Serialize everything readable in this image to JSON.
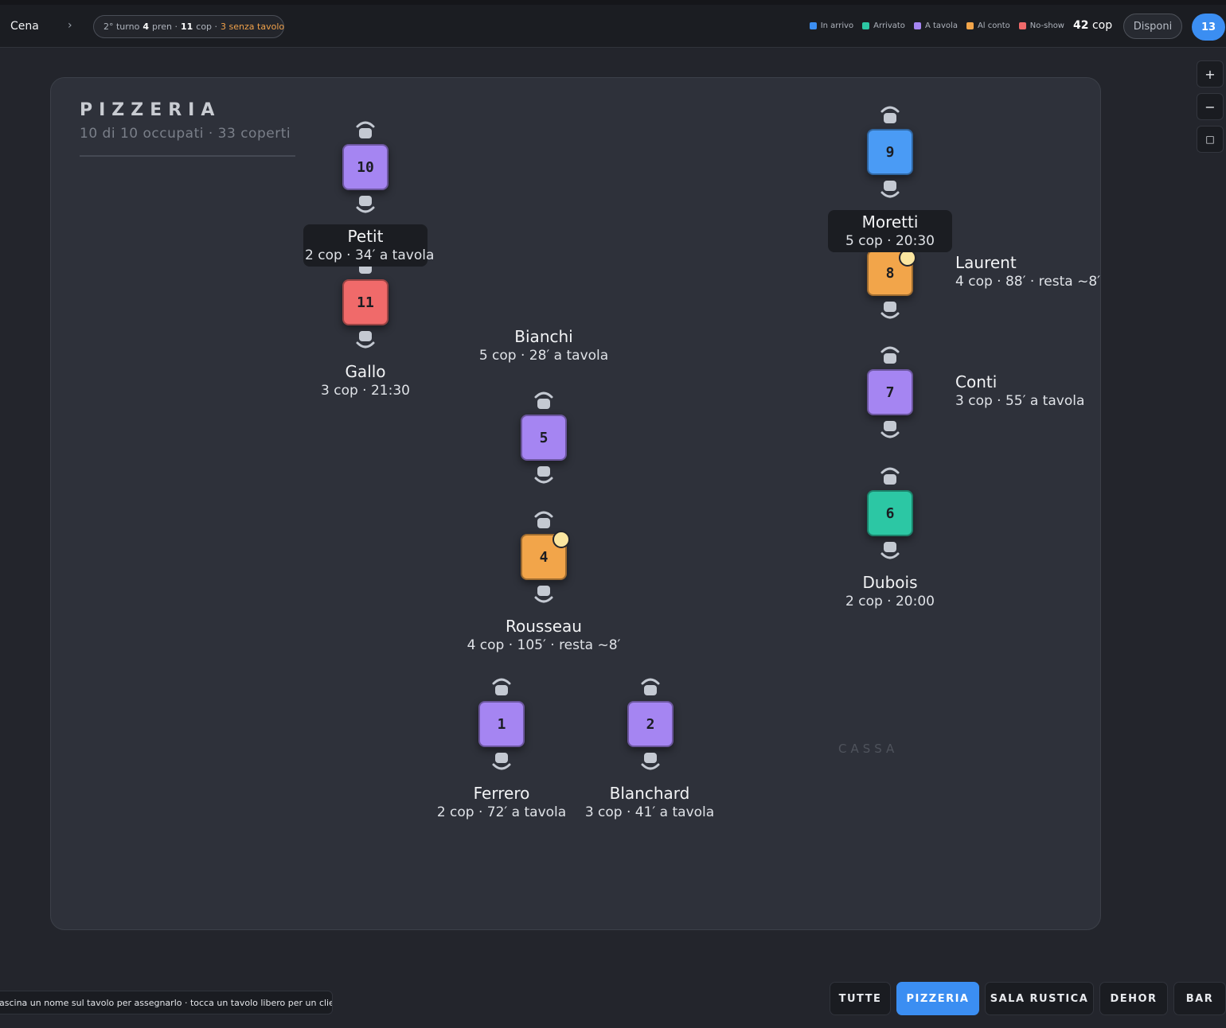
{
  "header": {
    "service": "Cena",
    "chevron": "›",
    "shift": {
      "turn": "2° turno",
      "reservations_num": "4",
      "reservations_label": "pren ·",
      "covers_num": "11",
      "covers_label": "cop ·",
      "unseated": "3 senza tavolo"
    },
    "legend": [
      {
        "label": "In arrivo",
        "color": "#3b8ef2"
      },
      {
        "label": "Arrivato",
        "color": "#2cc7a4"
      },
      {
        "label": "A tavola",
        "color": "#a585f2"
      },
      {
        "label": "Al conto",
        "color": "#f2a54a"
      },
      {
        "label": "No-show",
        "color": "#f06a6a"
      }
    ],
    "total_covers_num": "42",
    "total_covers_label": "cop",
    "disponi_label": "Disponi",
    "badge_count": "13"
  },
  "zoom": {
    "in": "+",
    "out": "−",
    "fit": "□"
  },
  "room": {
    "title": "PIZZERIA",
    "subtitle": "10 di 10 occupati · 33 coperti",
    "cassa_label": "CASSA"
  },
  "tables": [
    {
      "number": "10",
      "status": "A tavola",
      "color": "#a585f2"
    },
    {
      "number": "11",
      "status": "No-show",
      "color": "#f06a6a"
    },
    {
      "number": "9",
      "status": "In arrivo",
      "color": "#4a9bf5"
    },
    {
      "number": "8",
      "status": "Al conto",
      "color": "#f2a54a"
    },
    {
      "number": "7",
      "status": "A tavola",
      "color": "#a585f2"
    },
    {
      "number": "6",
      "status": "Arrivato",
      "color": "#2cc7a4"
    },
    {
      "number": "5",
      "status": "A tavola",
      "color": "#a585f2"
    },
    {
      "number": "4",
      "status": "Al conto",
      "color": "#f2a54a"
    },
    {
      "number": "1",
      "status": "A tavola",
      "color": "#a585f2"
    },
    {
      "number": "2",
      "status": "A tavola",
      "color": "#a585f2"
    }
  ],
  "guests": {
    "petit": {
      "name": "Petit",
      "meta": "2 cop · 34′ a tavola"
    },
    "gallo": {
      "name": "Gallo",
      "meta": "3 cop · 21:30"
    },
    "moretti": {
      "name": "Moretti",
      "meta": "5 cop · 20:30"
    },
    "laurent": {
      "name": "Laurent",
      "meta": "4 cop · 88′ · resta ~8′"
    },
    "conti": {
      "name": "Conti",
      "meta": "3 cop · 55′ a tavola"
    },
    "dubois": {
      "name": "Dubois",
      "meta": "2 cop · 20:00"
    },
    "bianchi": {
      "name": "Bianchi",
      "meta": "5 cop · 28′ a tavola"
    },
    "rousseau": {
      "name": "Rousseau",
      "meta": "4 cop · 105′ · resta ~8′"
    },
    "ferrero": {
      "name": "Ferrero",
      "meta": "2 cop · 72′ a tavola"
    },
    "blanchard": {
      "name": "Blanchard",
      "meta": "3 cop · 41′ a tavola"
    }
  },
  "footer": {
    "hint": "ascina un nome sul tavolo per assegnarlo · tocca un tavolo libero per un cliente al volo",
    "tabs": [
      "TUTTE",
      "PIZZERIA",
      "SALA RUSTICA",
      "DEHOR",
      "BAR"
    ],
    "active_tab": "PIZZERIA"
  }
}
